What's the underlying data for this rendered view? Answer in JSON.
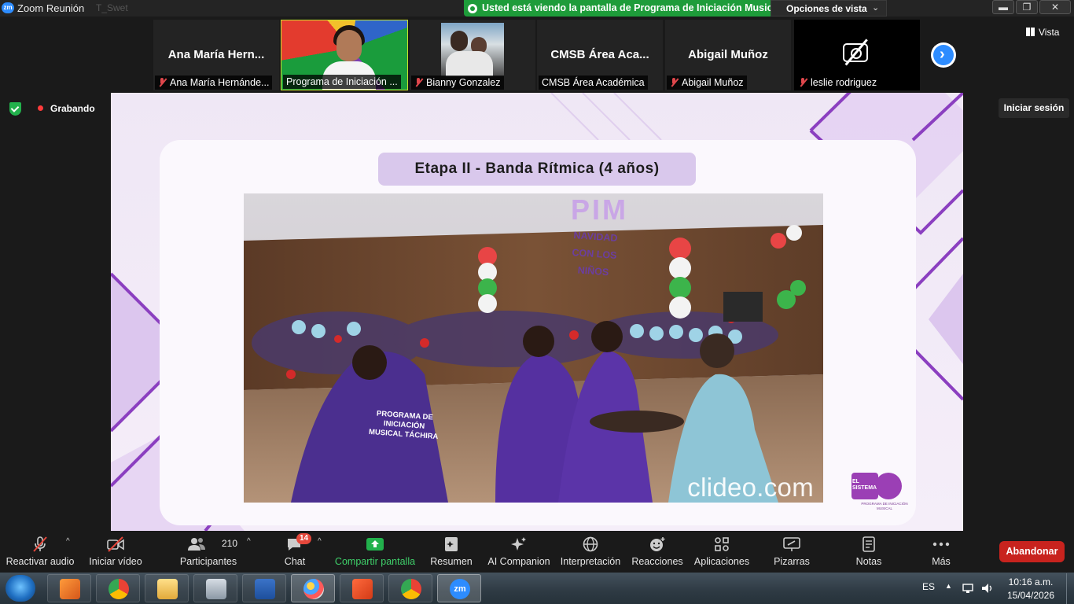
{
  "window": {
    "app_title": "Zoom Reunión",
    "ghost_title": "T_Swet",
    "minimize_symbol": "▬",
    "maximize_symbol": "❐",
    "close_symbol": "✕"
  },
  "share_banner": {
    "text": "Usted está viendo la pantalla de Programa de Iniciación Musical",
    "view_options": "Opciones de vista",
    "view_options_chevron": "⌄"
  },
  "participants": [
    {
      "display_name": "Ana María Hern...",
      "label": "Ana María Hernánde...",
      "muted": true,
      "video": "name"
    },
    {
      "display_name": "",
      "label": "Programa de Iniciación ...",
      "muted": false,
      "video": "camera",
      "active_speaker": true
    },
    {
      "display_name": "",
      "label": "Bianny Gonzalez",
      "muted": true,
      "video": "photo"
    },
    {
      "display_name": "CMSB Área Aca...",
      "label": "CMSB Área Académica",
      "muted": false,
      "video": "name"
    },
    {
      "display_name": "Abigail Muñoz",
      "label": "Abigail Muñoz",
      "muted": true,
      "video": "name"
    },
    {
      "display_name": "",
      "label": "leslie rodriguez",
      "muted": true,
      "video": "camera-off-icon"
    }
  ],
  "next_page_symbol": "›",
  "view_button": "Vista",
  "recording": {
    "label": "Grabando",
    "color": "#ff3b3b"
  },
  "sign_in_button": "Iniciar sesión",
  "slide": {
    "title": "Etapa II - Banda Rítmica (4 años)",
    "banner_sign": "PIM",
    "navidad_sign": "NAVIDAD CON LOS NIÑOS",
    "shirt_text": "PROGRAMA DE INICIACIÓN MUSICAL TÁCHIRA",
    "watermark": "clideo.com",
    "logo_name": "EL SISTEMA",
    "logo_sub": "PROGRAMA DE INICIACIÓN MUSICAL",
    "accent_color": "#8b3fc0"
  },
  "toolbar": {
    "items": [
      {
        "label": "Reactivar audio",
        "icon": "mic-muted-icon"
      },
      {
        "label": "Iniciar vídeo",
        "icon": "video-off-icon"
      },
      {
        "label": "Participantes",
        "icon": "participants-icon",
        "count": "210"
      },
      {
        "label": "Chat",
        "icon": "chat-icon",
        "badge": "14"
      },
      {
        "label": "Compartir pantalla",
        "icon": "share-screen-icon"
      },
      {
        "label": "Resumen",
        "icon": "summary-icon"
      },
      {
        "label": "AI Companion",
        "icon": "ai-companion-icon"
      },
      {
        "label": "Interpretación",
        "icon": "globe-icon"
      },
      {
        "label": "Reacciones",
        "icon": "reactions-icon"
      },
      {
        "label": "Aplicaciones",
        "icon": "apps-icon"
      },
      {
        "label": "Pizarras",
        "icon": "whiteboard-icon"
      },
      {
        "label": "Notas",
        "icon": "notes-icon"
      },
      {
        "label": "Más",
        "icon": "more-icon"
      }
    ],
    "caret": "^",
    "leave_button": "Abandonar",
    "share_color": "#22b14c",
    "leave_color": "#c8231e"
  },
  "taskbar": {
    "apps": [
      "media-player-icon",
      "chrome-icon",
      "file-explorer-icon",
      "calculator-icon",
      "word-icon",
      "paint-icon",
      "office-icon",
      "chrome-profile-icon",
      "zoom-icon"
    ],
    "language": "ES",
    "tray_caret": "▲",
    "time": "10:16 a.m.",
    "date": "15/04/2026"
  }
}
